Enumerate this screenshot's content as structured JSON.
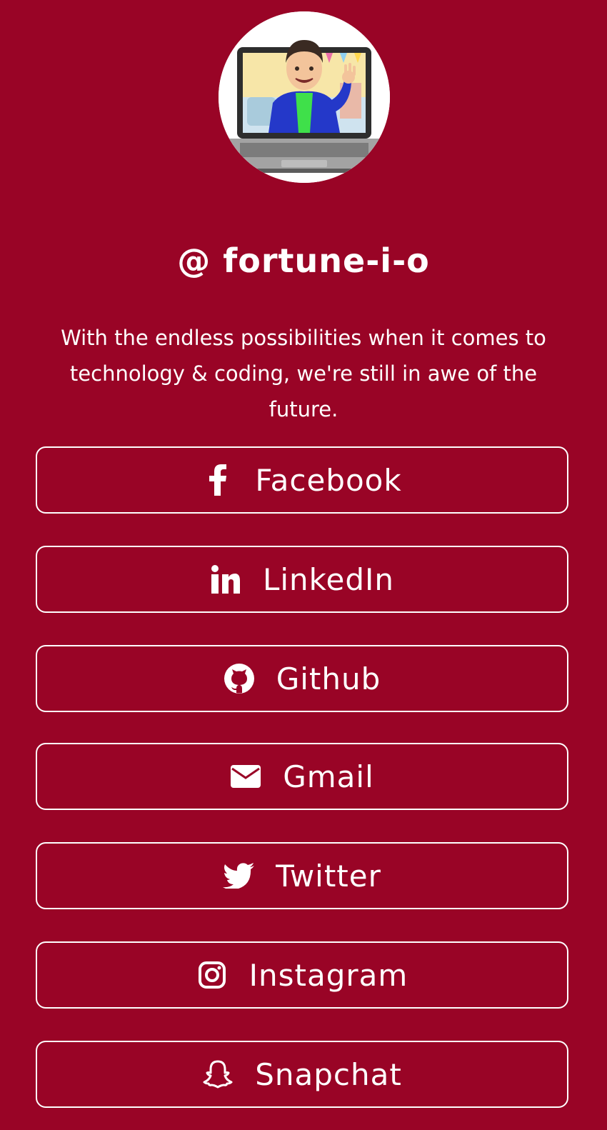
{
  "profile": {
    "handle": "@ fortune-i-o",
    "bio": "With the endless possibilities when it comes to technology & coding, we're still in awe of the future."
  },
  "links": [
    {
      "label": "Facebook",
      "icon": "facebook-icon"
    },
    {
      "label": "LinkedIn",
      "icon": "linkedin-icon"
    },
    {
      "label": "Github",
      "icon": "github-icon"
    },
    {
      "label": "Gmail",
      "icon": "envelope-icon"
    },
    {
      "label": "Twitter",
      "icon": "twitter-icon"
    },
    {
      "label": "Instagram",
      "icon": "instagram-icon"
    },
    {
      "label": "Snapchat",
      "icon": "snapchat-icon"
    }
  ],
  "colors": {
    "background": "#990426",
    "foreground": "#ffffff"
  }
}
